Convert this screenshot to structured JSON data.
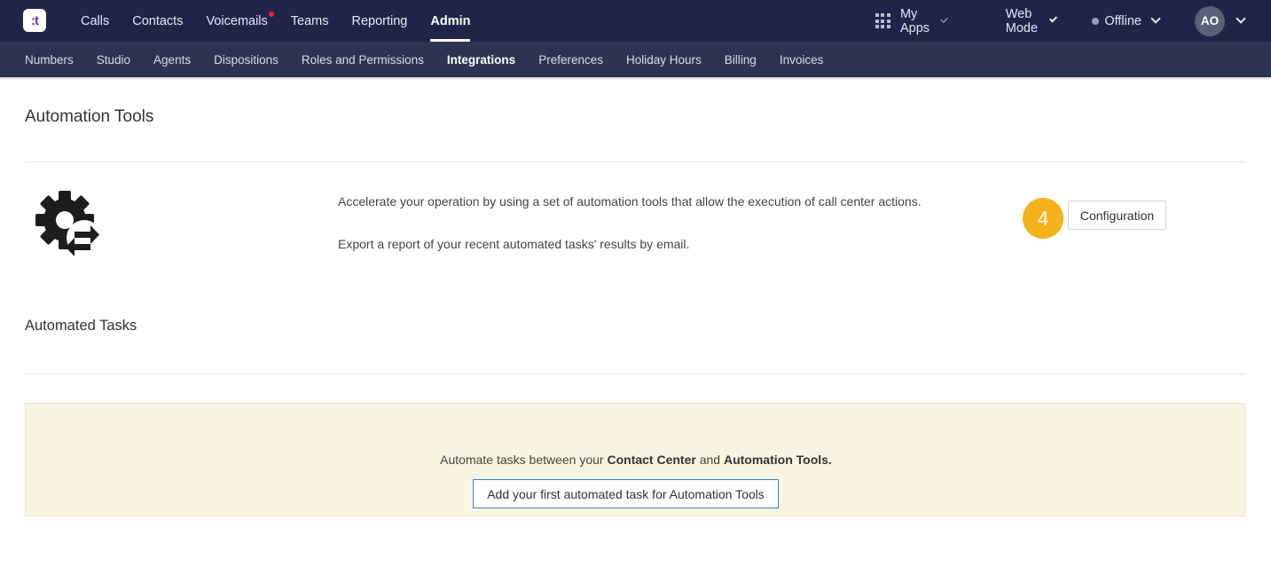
{
  "brand": {
    "logo_text": ":t"
  },
  "nav": {
    "items": [
      {
        "label": "Calls"
      },
      {
        "label": "Contacts"
      },
      {
        "label": "Voicemails",
        "notification": true
      },
      {
        "label": "Teams"
      },
      {
        "label": "Reporting"
      },
      {
        "label": "Admin",
        "active": true
      }
    ]
  },
  "toolbar": {
    "my_apps_label": "My Apps",
    "web_mode_label": "Web Mode",
    "status_label": "Offline",
    "avatar_initials": "AO"
  },
  "subnav": {
    "items": [
      {
        "label": "Numbers"
      },
      {
        "label": "Studio"
      },
      {
        "label": "Agents"
      },
      {
        "label": "Dispositions"
      },
      {
        "label": "Roles and Permissions"
      },
      {
        "label": "Integrations",
        "active": true
      },
      {
        "label": "Preferences"
      },
      {
        "label": "Holiday Hours"
      },
      {
        "label": "Billing"
      },
      {
        "label": "Invoices"
      }
    ]
  },
  "page": {
    "title": "Automation Tools",
    "description_1": "Accelerate your operation by using a set of automation tools that allow the execution of call center actions.",
    "description_2": "Export a report of your recent automated tasks' results by email.",
    "step_number": "4",
    "configuration_label": "Configuration",
    "section_title": "Automated Tasks",
    "empty_prefix": "Automate tasks between your ",
    "empty_bold_1": "Contact Center",
    "empty_middle": " and ",
    "empty_bold_2": "Automation Tools.",
    "add_task_label": "Add your first automated task for Automation Tools"
  },
  "icons": {
    "logo": "talkdesk-logo-icon",
    "apps": "grid-icon",
    "automation": "gear-arrows-icon",
    "chevron": "chevron-down-icon",
    "status": "status-dot-icon"
  },
  "colors": {
    "topbar": "#1f2549",
    "subbar": "#2d3452",
    "notification": "#e8243a",
    "step_badge": "#f7b21b",
    "empty_panel": "#f8f6e0",
    "primary_border": "#3d86c6"
  }
}
